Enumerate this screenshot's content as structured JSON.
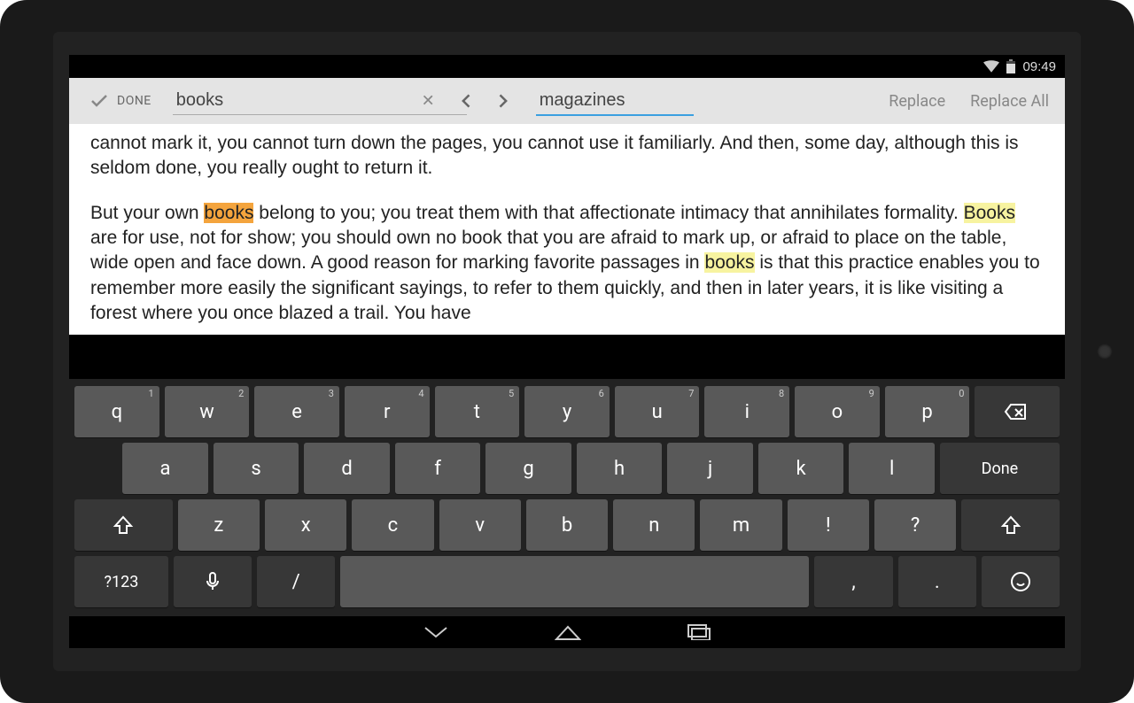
{
  "status": {
    "time": "09:49"
  },
  "findbar": {
    "done_label": "DONE",
    "search_value": "books",
    "replace_value": "magazines",
    "replace_label": "Replace",
    "replace_all_label": "Replace All"
  },
  "text": {
    "p1_a": "cannot mark it, you cannot turn down the pages, you cannot use it familiarly. And then, some day, although this is seldom done, you really ought to return it.",
    "p2_a": "But your own ",
    "p2_b": "books",
    "p2_c": " belong to you; you treat them with that affectionate intimacy that annihilates formality. ",
    "p2_d": "Books",
    "p2_e": " are for use, not for show; you should own no book that you are afraid to mark up, or afraid to place on the table, wide open and face down. A good reason for marking favorite passages in ",
    "p2_f": "books",
    "p2_g": " is that this practice enables you to remember more easily the significant sayings, to refer to them quickly, and then in later years, it is like visiting a forest where you once blazed a trail. You have"
  },
  "keyboard": {
    "row1": [
      {
        "l": "q",
        "s": "1"
      },
      {
        "l": "w",
        "s": "2"
      },
      {
        "l": "e",
        "s": "3"
      },
      {
        "l": "r",
        "s": "4"
      },
      {
        "l": "t",
        "s": "5"
      },
      {
        "l": "y",
        "s": "6"
      },
      {
        "l": "u",
        "s": "7"
      },
      {
        "l": "i",
        "s": "8"
      },
      {
        "l": "o",
        "s": "9"
      },
      {
        "l": "p",
        "s": "0"
      }
    ],
    "row2": [
      "a",
      "s",
      "d",
      "f",
      "g",
      "h",
      "j",
      "k",
      "l"
    ],
    "row3": [
      "z",
      "x",
      "c",
      "v",
      "b",
      "n",
      "m",
      "!",
      "?"
    ],
    "done_label": "Done",
    "sym_label": "?123",
    "slash": "/",
    "comma": ",",
    "period": "."
  }
}
